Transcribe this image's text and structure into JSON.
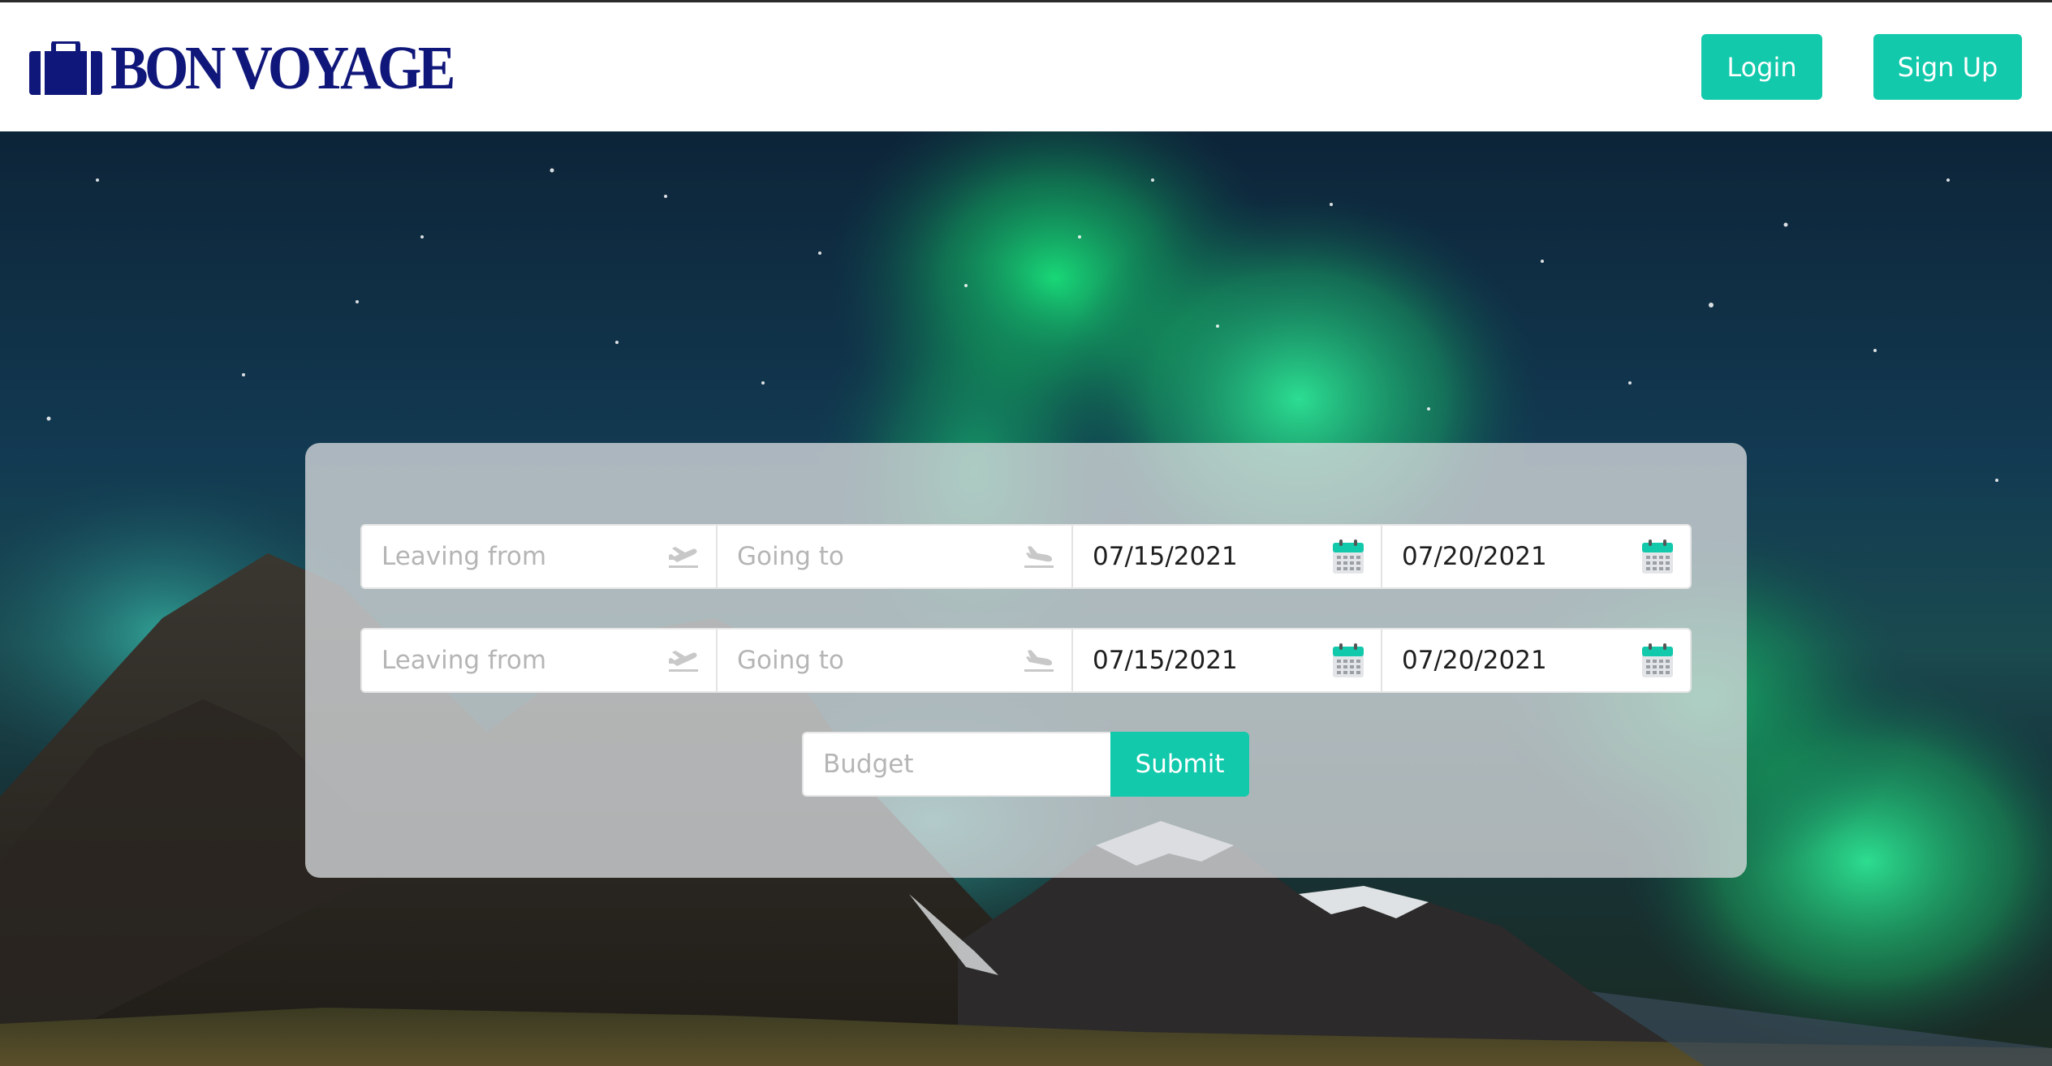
{
  "header": {
    "brand": "Bon Voyage",
    "login_label": "Login",
    "signup_label": "Sign Up"
  },
  "search": {
    "rows": [
      {
        "leaving_placeholder": "Leaving from",
        "going_placeholder": "Going to",
        "depart_date": "07/15/2021",
        "return_date": "07/20/2021"
      },
      {
        "leaving_placeholder": "Leaving from",
        "going_placeholder": "Going to",
        "depart_date": "07/15/2021",
        "return_date": "07/20/2021"
      }
    ],
    "budget_placeholder": "Budget",
    "submit_label": "Submit"
  },
  "icons": {
    "logo": "suitcase-icon",
    "leaving": "plane-takeoff-icon",
    "going": "plane-landing-icon",
    "date": "calendar-icon"
  },
  "colors": {
    "accent": "#12c9ac",
    "brand": "#10177a",
    "header_bg": "#ffffff",
    "placeholder": "#b5b5b5"
  }
}
